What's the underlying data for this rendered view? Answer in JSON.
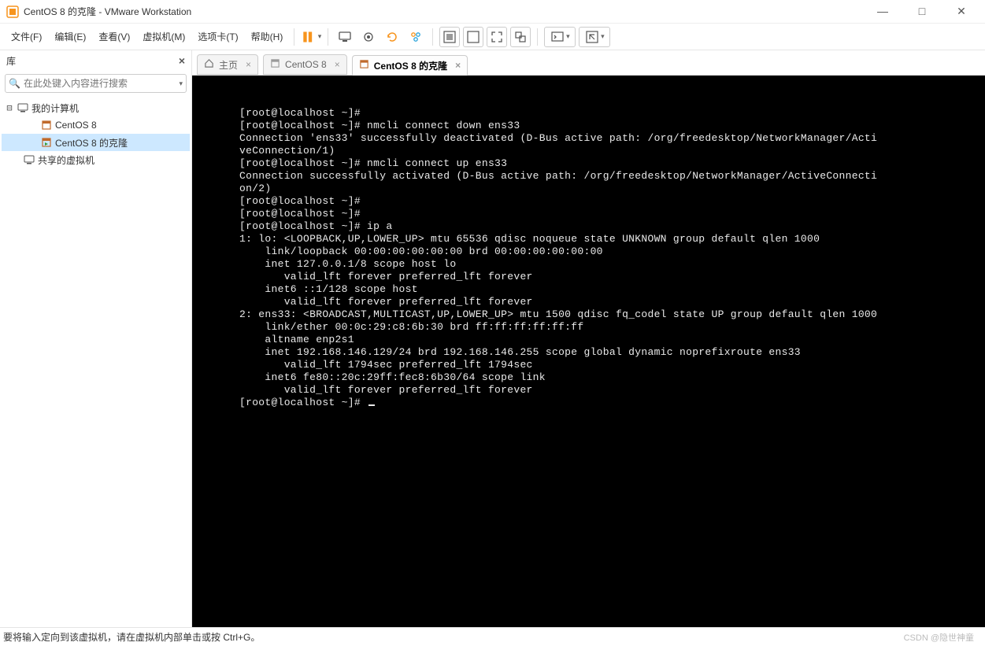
{
  "window": {
    "title": "CentOS 8 的克隆 - VMware Workstation"
  },
  "menubar": {
    "file": "文件(F)",
    "edit": "编辑(E)",
    "view": "查看(V)",
    "vm": "虚拟机(M)",
    "tabs": "选项卡(T)",
    "help": "帮助(H)"
  },
  "sidebar": {
    "title": "库",
    "search_placeholder": "在此处键入内容进行搜索",
    "root": "我的计算机",
    "items": [
      "CentOS 8",
      "CentOS 8 的克隆"
    ],
    "shared": "共享的虚拟机"
  },
  "tabs": {
    "home": "主页",
    "t1": "CentOS 8",
    "t2": "CentOS 8 的克隆"
  },
  "terminal_lines": [
    "[root@localhost ~]#",
    "[root@localhost ~]# nmcli connect down ens33",
    "Connection 'ens33' successfully deactivated (D-Bus active path: /org/freedesktop/NetworkManager/Acti",
    "veConnection/1)",
    "[root@localhost ~]# nmcli connect up ens33",
    "Connection successfully activated (D-Bus active path: /org/freedesktop/NetworkManager/ActiveConnecti",
    "on/2)",
    "[root@localhost ~]#",
    "[root@localhost ~]#",
    "[root@localhost ~]# ip a",
    "1: lo: <LOOPBACK,UP,LOWER_UP> mtu 65536 qdisc noqueue state UNKNOWN group default qlen 1000",
    "    link/loopback 00:00:00:00:00:00 brd 00:00:00:00:00:00",
    "    inet 127.0.0.1/8 scope host lo",
    "       valid_lft forever preferred_lft forever",
    "    inet6 ::1/128 scope host",
    "       valid_lft forever preferred_lft forever",
    "2: ens33: <BROADCAST,MULTICAST,UP,LOWER_UP> mtu 1500 qdisc fq_codel state UP group default qlen 1000",
    "    link/ether 00:0c:29:c8:6b:30 brd ff:ff:ff:ff:ff:ff",
    "    altname enp2s1",
    "    inet 192.168.146.129/24 brd 192.168.146.255 scope global dynamic noprefixroute ens33",
    "       valid_lft 1794sec preferred_lft 1794sec",
    "    inet6 fe80::20c:29ff:fec8:6b30/64 scope link",
    "       valid_lft forever preferred_lft forever",
    "[root@localhost ~]# "
  ],
  "statusbar": {
    "text": "要将输入定向到该虚拟机，请在虚拟机内部单击或按 Ctrl+G。"
  },
  "watermark": "CSDN @隐世神童"
}
